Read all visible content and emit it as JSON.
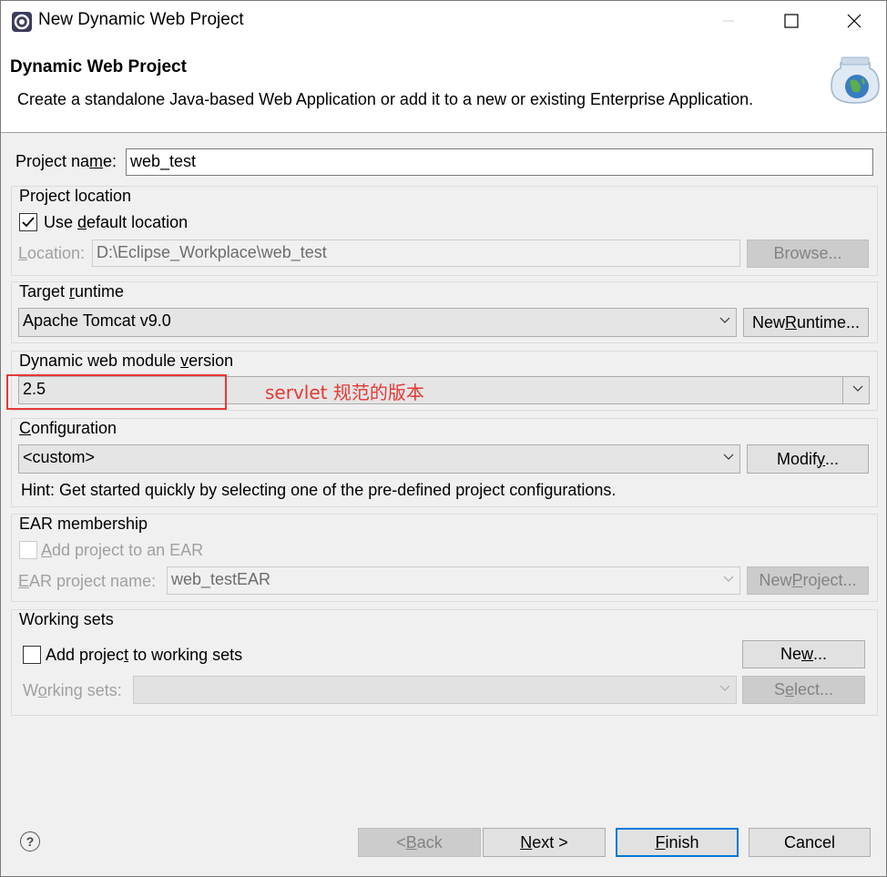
{
  "window": {
    "title": "New Dynamic Web Project",
    "controls": {
      "minimize": "minimize-icon",
      "maximize": "maximize-icon",
      "close": "close-icon"
    }
  },
  "banner": {
    "title": "Dynamic Web Project",
    "description": "Create a standalone Java-based Web Application or add it to a new or existing Enterprise Application.",
    "icon": "web-project-globe-icon"
  },
  "project_name": {
    "label_pre": "Project na",
    "label_mnemonic": "m",
    "label_post": "e:",
    "value": "web_test"
  },
  "project_location": {
    "group_label": "Project location",
    "use_default": {
      "label_pre": "Use ",
      "label_mnemonic": "d",
      "label_post": "efault location",
      "checked": true
    },
    "location_label_mnemonic": "L",
    "location_label_post": "ocation:",
    "location_value": "D:\\Eclipse_Workplace\\web_test",
    "browse_button": "Browse..."
  },
  "target_runtime": {
    "label_pre": "Target ",
    "label_mnemonic": "r",
    "label_post": "untime",
    "selected": "Apache Tomcat v9.0",
    "new_runtime_pre": "New ",
    "new_runtime_mnemonic": "R",
    "new_runtime_post": "untime..."
  },
  "module_version": {
    "label_pre": "Dynamic web module ",
    "label_mnemonic": "v",
    "label_post": "ersion",
    "selected": "2.5"
  },
  "annotation": {
    "text": "servlet 规范的版本",
    "color": "#e53935"
  },
  "configuration": {
    "label_mnemonic": "C",
    "label_post": "onfiguration",
    "selected": "<custom>",
    "modify_pre": "Modif",
    "modify_mnemonic": "y",
    "modify_post": "...",
    "hint": "Hint: Get started quickly by selecting one of the pre-defined project configurations."
  },
  "ear_membership": {
    "group_label": "EAR membership",
    "add_pre": "",
    "add_mnemonic": "A",
    "add_post": "dd project to an EAR",
    "add_checked": false,
    "ear_name_mnemonic": "E",
    "ear_name_post": "AR project name:",
    "ear_name_value": "web_testEAR",
    "new_project_pre": "New ",
    "new_project_mnemonic": "P",
    "new_project_post": "roject..."
  },
  "working_sets": {
    "group_label": "Working sets",
    "add_pre": "Add projec",
    "add_mnemonic": "t",
    "add_post": " to working sets",
    "add_checked": false,
    "new_pre": "Ne",
    "new_mnemonic": "w",
    "new_post": "...",
    "sets_pre": "W",
    "sets_mnemonic": "o",
    "sets_post": "rking sets:",
    "select_pre": "S",
    "select_mnemonic": "e",
    "select_post": "lect..."
  },
  "footer": {
    "help_icon": "help-icon",
    "help_glyph": "?",
    "back_pre": "< ",
    "back_mnemonic": "B",
    "back_post": "ack",
    "next_mnemonic": "N",
    "next_post": "ext >",
    "finish_mnemonic": "F",
    "finish_post": "inish",
    "cancel": "Cancel"
  },
  "colors": {
    "accent": "#0078d7",
    "annotation": "#e53935",
    "dialog_bg": "#f0f0f0"
  }
}
